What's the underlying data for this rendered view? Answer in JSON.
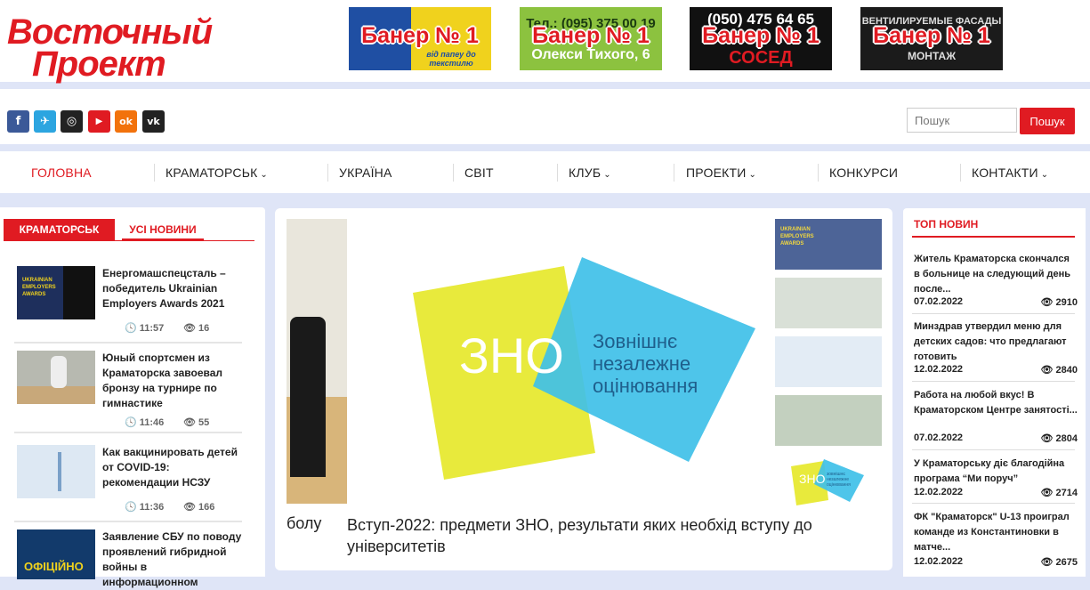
{
  "logo": {
    "line1": "Восточный",
    "line2": "Проект"
  },
  "banners": [
    {
      "label": "Банер № 1",
      "bg_text": "від папеу до текстилю"
    },
    {
      "label": "Банер № 1",
      "bg_text": "Олекси Тихого, 6",
      "bg_top": "Тел.: (095) 375 00 19"
    },
    {
      "label": "Банер № 1",
      "bg_text": "СОСЕД",
      "bg_top": "(050) 475 64 65"
    },
    {
      "label": "Банер № 1",
      "bg_text": "МОНТАЖ",
      "bg_top": "ВЕНТИЛИРУЕМЫЕ ФАСАДЫ"
    }
  ],
  "social": [
    {
      "icon": "facebook-icon",
      "glyph": "f",
      "color": "#3b5998"
    },
    {
      "icon": "telegram-icon",
      "glyph": "✈",
      "color": "#2ca5e0"
    },
    {
      "icon": "instagram-icon",
      "glyph": "◎",
      "color": "#222222"
    },
    {
      "icon": "youtube-icon",
      "glyph": "▶",
      "color": "#e01b22"
    },
    {
      "icon": "odnoklassniki-icon",
      "glyph": "ok",
      "color": "#f2720c"
    },
    {
      "icon": "vk-icon",
      "glyph": "vk",
      "color": "#222222"
    }
  ],
  "search": {
    "placeholder": "Пошук",
    "button": "Пошук"
  },
  "nav": {
    "items": [
      {
        "label": "ГОЛОВНА",
        "active": true
      },
      {
        "label": "КРАМАТОРСЬК",
        "dropdown": true
      },
      {
        "label": "УКРАЇНА"
      },
      {
        "label": "СВІТ"
      },
      {
        "label": "КЛУБ",
        "dropdown": true
      },
      {
        "label": "ПРОЕКТИ",
        "dropdown": true
      },
      {
        "label": "КОНКУРСИ"
      },
      {
        "label": "КОНТАКТИ",
        "dropdown": true
      }
    ]
  },
  "left": {
    "tab_active": "КРАМАТОРСЬК",
    "tab_inactive": "УСІ НОВИНИ",
    "news": [
      {
        "title": "Енергомашспецсталь – победитель Ukrainian Employers Awards 2021",
        "time": "11:57",
        "views": "16"
      },
      {
        "title": "Юный спортсмен из Краматорска завоевал бронзу на турнире по гимнастике",
        "time": "11:46",
        "views": "55"
      },
      {
        "title": "Как вакцинировать детей от COVID-19: рекомендации НСЗУ",
        "time": "11:36",
        "views": "166"
      },
      {
        "title": "Заявление СБУ по поводу проявлений гибридной войны в информационном"
      }
    ],
    "thumb_labels": [
      "UKRAINIAN EMPLOYERS AWARDS",
      "ОФІЦІЙНО"
    ]
  },
  "slider": {
    "prev_caption": "болу",
    "caption": "Вступ-2022: предмети ЗНО, результати яких необхід вступу до університетів",
    "zno": {
      "abbr": "ЗНО",
      "line1": "Зовнішнє",
      "line2": "незалежне",
      "line3": "оцінювання"
    },
    "thumb_label": "UKRAINIAN EMPLOYERS AWARDS",
    "thumb_zno": "ЗНО",
    "thumb_zno_text": "зовнішнє незалежне оцінювання"
  },
  "top": {
    "title": "ТОП НОВИН",
    "items": [
      {
        "text": "Житель Краматорска скончался в больнице на следующий день после...",
        "date": "07.02.2022",
        "views": "2910"
      },
      {
        "text": "Минздрав утвердил меню для детских садов: что предлагают готовить",
        "date": "12.02.2022",
        "views": "2840"
      },
      {
        "text": "Работа на любой вкус! В Краматорском Центре занятості...",
        "date": "07.02.2022",
        "views": "2804"
      },
      {
        "text": "У Краматорську діє благодійна програма “Ми поруч”",
        "date": "12.02.2022",
        "views": "2714"
      },
      {
        "text": "ФК \"Краматорск\" U-13 проиграл команде из Константиновки в матче...",
        "date": "12.02.2022",
        "views": "2675"
      }
    ]
  }
}
